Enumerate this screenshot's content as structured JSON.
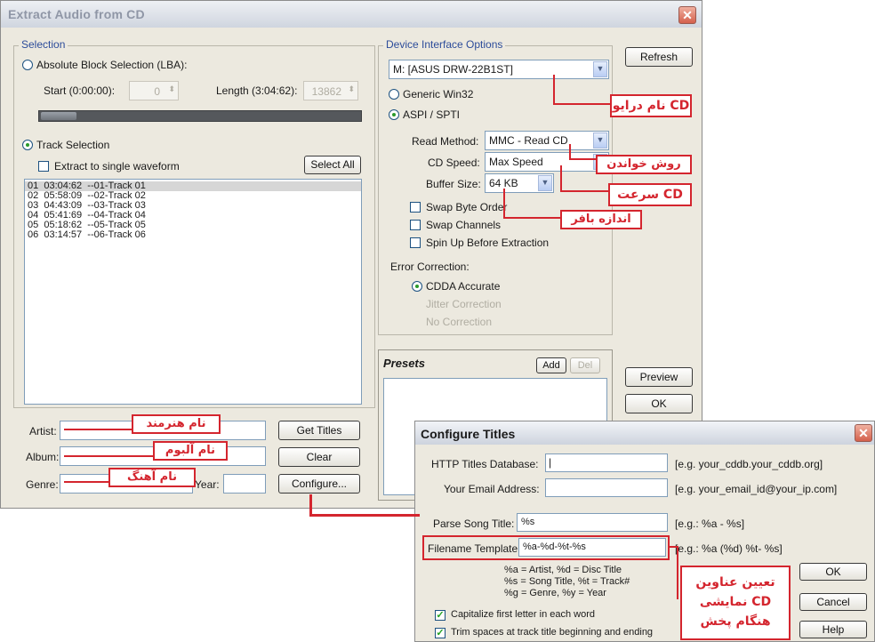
{
  "main": {
    "title": "Extract Audio from CD",
    "close": "✕",
    "selection": {
      "group_label": "Selection",
      "lba_label": "Absolute Block Selection (LBA):",
      "start_label": "Start (0:00:00):",
      "start_value": "0",
      "length_label": "Length (3:04:62):",
      "length_value": "13862",
      "track_selection_label": "Track Selection",
      "extract_single_label": "Extract to single waveform",
      "select_all": "Select All",
      "tracks": [
        "01  03:04:62  --01-Track 01",
        "02  05:58:09  --02-Track 02",
        "03  04:43:09  --03-Track 03",
        "04  05:41:69  --04-Track 04",
        "05  05:18:62  --05-Track 05",
        "06  03:14:57  --06-Track 06"
      ]
    },
    "artist_label": "Artist:",
    "album_label": "Album:",
    "genre_label": "Genre:",
    "year_label": "Year:",
    "get_titles": "Get Titles",
    "clear": "Clear",
    "configure": "Configure...",
    "device": {
      "group_label": "Device Interface Options",
      "drive": "M: [ASUS DRW-22B1ST]",
      "generic": "Generic Win32",
      "aspi": "ASPI / SPTI",
      "read_method_label": "Read Method:",
      "read_method": "MMC - Read CD",
      "cd_speed_label": "CD Speed:",
      "cd_speed": "Max Speed",
      "buffer_label": "Buffer Size:",
      "buffer": "64 KB",
      "swap_byte": "Swap Byte Order",
      "swap_channels": "Swap Channels",
      "spin_up": "Spin Up Before Extraction",
      "error_label": "Error Correction:",
      "cdda": "CDDA Accurate",
      "jitter": "Jitter Correction",
      "no_correction": "No Correction"
    },
    "refresh": "Refresh",
    "presets_label": "Presets",
    "add": "Add",
    "del": "Del",
    "preview": "Preview",
    "ok": "OK"
  },
  "configure": {
    "title": "Configure Titles",
    "close": "✕",
    "http_label": "HTTP Titles Database:",
    "http_value": "|",
    "http_hint": "[e.g. your_cddb.your_cddb.org]",
    "email_label": "Your Email Address:",
    "email_value": "",
    "email_hint": "[e.g. your_email_id@your_ip.com]",
    "parse_label": "Parse Song Title:",
    "parse_value": "%s",
    "parse_hint": "[e.g.: %a - %s]",
    "filename_label": "Filename Template:",
    "filename_value": "%a-%d-%t-%s",
    "filename_hint": "[e.g.: %a (%d) %t- %s]",
    "legend1": "%a = Artist, %d = Disc Title",
    "legend2": "%s = Song Title, %t = Track#",
    "legend3": "%g = Genre, %y = Year",
    "capitalize": "Capitalize first letter in each word",
    "trim": "Trim spaces at track title beginning and ending",
    "ok": "OK",
    "cancel": "Cancel",
    "help": "Help"
  },
  "callouts": {
    "drive_name": "نام درایو CD",
    "read_method": "روش خواندن",
    "speed": "سرعت CD",
    "buffer": "اندازه بافر",
    "artist": "نام هنرمند",
    "album": "نام آلبوم",
    "genre": "نام آهنگ",
    "titles_1": "تعیین عناوین",
    "titles_2": "نمایشی CD",
    "titles_3": "هنگام پخش"
  }
}
